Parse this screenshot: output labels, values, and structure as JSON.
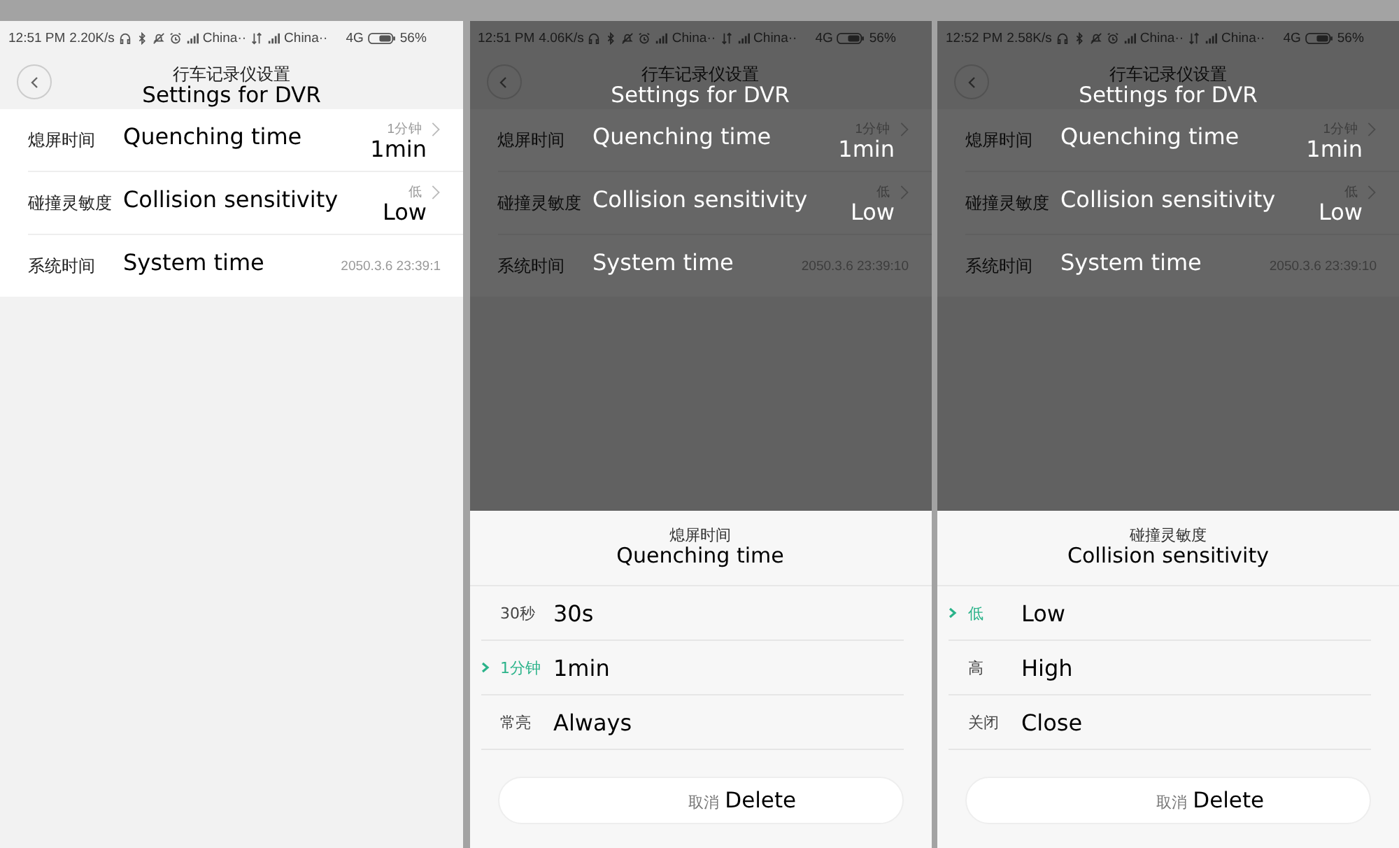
{
  "screens": [
    {
      "dimmed": false,
      "status": {
        "time": "12:51 PM",
        "speed": "2.20K/s",
        "carrier_1": "China··",
        "carrier_2": "China··",
        "network": "4G",
        "battery": "56%"
      },
      "header": {
        "title": "行车记录仪设置",
        "title_en": "Settings for DVR"
      },
      "rows": [
        {
          "label": "熄屏时间",
          "label_en": "Quenching time",
          "value": "1分钟",
          "value_en": "1min",
          "chevron": true
        },
        {
          "label": "碰撞灵敏度",
          "label_en": "Collision sensitivity",
          "value": "低",
          "value_en": "Low",
          "chevron": true
        },
        {
          "label": "系统时间",
          "label_en": "System time",
          "value": "2050.3.6 23:39:1",
          "chevron": false
        }
      ]
    },
    {
      "dimmed": true,
      "status": {
        "time": "12:51 PM",
        "speed": "4.06K/s",
        "carrier_1": "China··",
        "carrier_2": "China··",
        "network": "4G",
        "battery": "56%"
      },
      "header": {
        "title": "行车记录仪设置",
        "title_en": "Settings for DVR"
      },
      "rows": [
        {
          "label": "熄屏时间",
          "label_en": "Quenching time",
          "value": "1分钟",
          "value_en": "1min",
          "chevron": true
        },
        {
          "label": "碰撞灵敏度",
          "label_en": "Collision sensitivity",
          "value": "低",
          "value_en": "Low",
          "chevron": true
        },
        {
          "label": "系统时间",
          "label_en": "System time",
          "value": "2050.3.6 23:39:10",
          "chevron": false
        }
      ],
      "sheet": {
        "title": "熄屏时间",
        "title_en": "Quenching time",
        "options": [
          {
            "label": "30秒",
            "label_en": "30s",
            "selected": false
          },
          {
            "label": "1分钟",
            "label_en": "1min",
            "selected": true
          },
          {
            "label": "常亮",
            "label_en": "Always",
            "selected": false
          }
        ],
        "cancel": "取消",
        "cancel_en": "Delete"
      }
    },
    {
      "dimmed": true,
      "status": {
        "time": "12:52 PM",
        "speed": "2.58K/s",
        "carrier_1": "China··",
        "carrier_2": "China··",
        "network": "4G",
        "battery": "56%"
      },
      "header": {
        "title": "行车记录仪设置",
        "title_en": "Settings for DVR"
      },
      "rows": [
        {
          "label": "熄屏时间",
          "label_en": "Quenching time",
          "value": "1分钟",
          "value_en": "1min",
          "chevron": true
        },
        {
          "label": "碰撞灵敏度",
          "label_en": "Collision sensitivity",
          "value": "低",
          "value_en": "Low",
          "chevron": true
        },
        {
          "label": "系统时间",
          "label_en": "System time",
          "value": "2050.3.6 23:39:10",
          "chevron": false
        }
      ],
      "sheet": {
        "title": "碰撞灵敏度",
        "title_en": "Collision sensitivity",
        "options": [
          {
            "label": "低",
            "label_en": "Low",
            "selected": true
          },
          {
            "label": "高",
            "label_en": "High",
            "selected": false
          },
          {
            "label": "关闭",
            "label_en": "Close",
            "selected": false
          }
        ],
        "cancel": "取消",
        "cancel_en": "Delete"
      }
    }
  ]
}
